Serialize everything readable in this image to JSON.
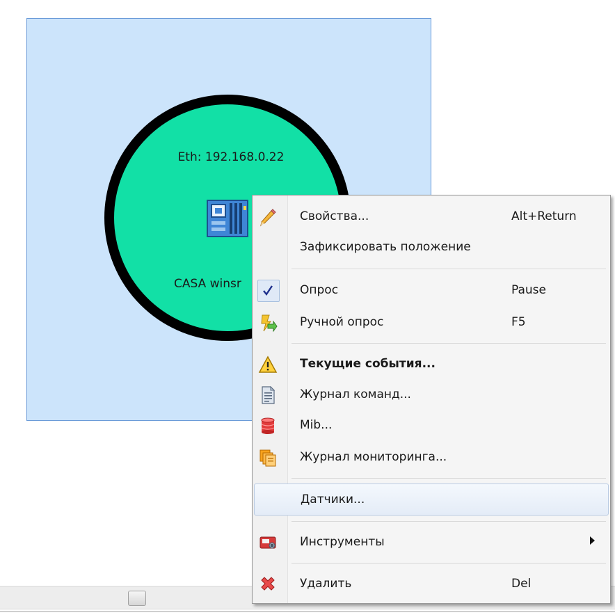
{
  "node": {
    "ip_label": "Eth: 192.168.0.22",
    "name_label": "CASA winsr"
  },
  "context_menu": {
    "items": [
      {
        "label": "Свойства...",
        "shortcut": "Alt+Return",
        "icon": "pencil-icon"
      },
      {
        "label": "Зафиксировать положение",
        "shortcut": "",
        "icon": ""
      },
      {
        "label": "Опрос",
        "shortcut": "Pause",
        "icon": "checkmark-icon",
        "checked": true
      },
      {
        "label": "Ручной опрос",
        "shortcut": "F5",
        "icon": "manual-poll-icon"
      },
      {
        "label": "Текущие события...",
        "shortcut": "",
        "icon": "warning-icon",
        "bold": true
      },
      {
        "label": "Журнал команд...",
        "shortcut": "",
        "icon": "document-icon"
      },
      {
        "label": "Mib...",
        "shortcut": "",
        "icon": "database-icon"
      },
      {
        "label": "Журнал мониторинга...",
        "shortcut": "",
        "icon": "monitoring-log-icon"
      },
      {
        "label": "Датчики...",
        "shortcut": "",
        "icon": "",
        "hovered": true
      },
      {
        "label": "Инструменты",
        "shortcut": "",
        "icon": "tools-icon",
        "submenu": true
      },
      {
        "label": "Удалить",
        "shortcut": "Del",
        "icon": "delete-icon"
      }
    ]
  },
  "colors": {
    "selection_fill": "#cce4fb",
    "node_fill": "#12e0a6",
    "node_border": "#000000"
  }
}
